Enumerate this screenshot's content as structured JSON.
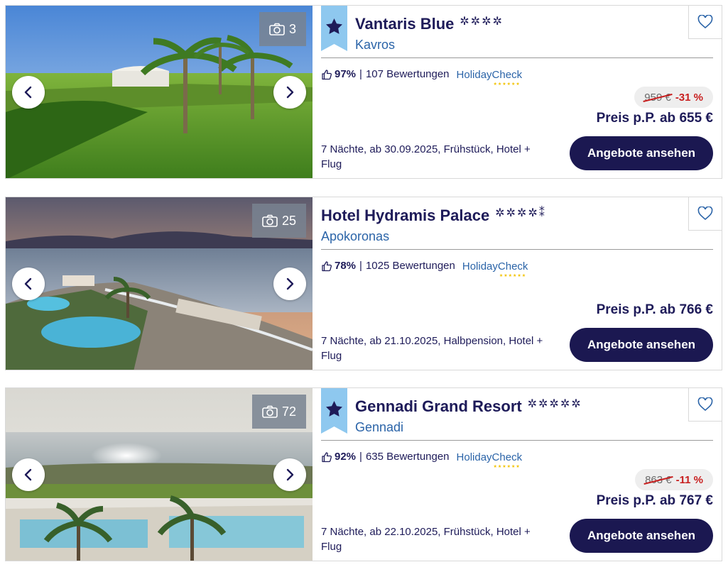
{
  "colors": {
    "navy": "#1e1b59",
    "link_blue": "#2b64a8",
    "discount_red": "#c82020",
    "ribbon_blue": "#8ec8ef",
    "cta_bg": "#1b1851"
  },
  "icons": {
    "photo": "camera-icon",
    "prev": "chevron-left-icon",
    "next": "chevron-right-icon",
    "favorite": "heart-icon",
    "rating": "thumbs-up-icon",
    "ribbon": "star-icon"
  },
  "hotels": [
    {
      "name": "Vantaris Blue",
      "stars": "✲✲✲✲",
      "location": "Kavros",
      "photo_count": "3",
      "rating_pct": "97%",
      "separator": "|",
      "reviews": "107 Bewertungen",
      "review_source": "HolidayCheck",
      "review_dots": "★★★★★★",
      "old_price": "959 €",
      "discount": "-31 %",
      "price": "Preis p.P. ab 655 €",
      "details": "7 Nächte, ab 30.09.2025, Frühstück, Hotel + Flug",
      "cta": "Angebote ansehen"
    },
    {
      "name": "Hotel Hydramis Palace",
      "stars": "✲✲✲✲⁑",
      "location": "Apokoronas",
      "photo_count": "25",
      "rating_pct": "78%",
      "separator": "|",
      "reviews": "1025 Bewertungen",
      "review_source": "HolidayCheck",
      "review_dots": "★★★★★★",
      "price": "Preis p.P. ab 766 €",
      "details": "7 Nächte, ab 21.10.2025, Halbpension, Hotel + Flug",
      "cta": "Angebote ansehen"
    },
    {
      "name": "Gennadi Grand Resort",
      "stars": "✲✲✲✲✲",
      "location": "Gennadi",
      "photo_count": "72",
      "rating_pct": "92%",
      "separator": "|",
      "reviews": "635 Bewertungen",
      "review_source": "HolidayCheck",
      "review_dots": "★★★★★★",
      "old_price": "863 €",
      "discount": "-11 %",
      "price": "Preis p.P. ab 767 €",
      "details": "7 Nächte, ab 22.10.2025, Frühstück, Hotel + Flug",
      "cta": "Angebote ansehen"
    }
  ]
}
